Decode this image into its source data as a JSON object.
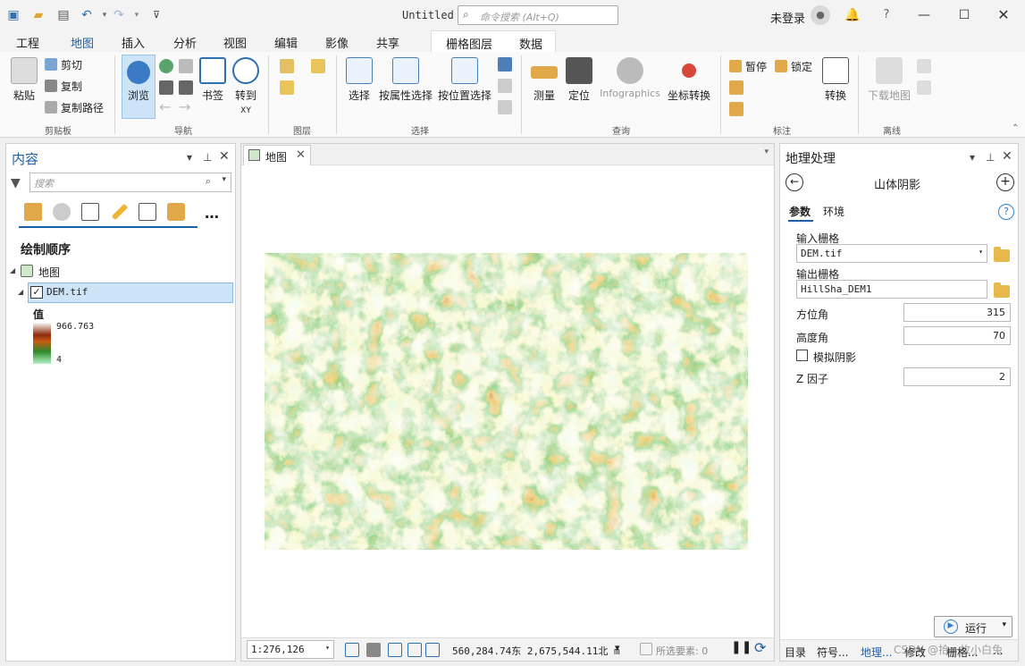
{
  "titlebar": {
    "title": "Untitled",
    "search_placeholder": "命令搜索 (Alt+Q)",
    "login": "未登录",
    "help": "?",
    "icons": [
      "new-project-icon",
      "open-icon",
      "save-icon",
      "undo-icon",
      "redo-icon",
      "customize-icon"
    ]
  },
  "tabs": [
    "工程",
    "地图",
    "插入",
    "分析",
    "视图",
    "编辑",
    "影像",
    "共享"
  ],
  "active_tab": "地图",
  "context_tabs": [
    "栅格图层",
    "数据"
  ],
  "ribbon": {
    "clipboard": {
      "paste": "粘贴",
      "cut": "剪切",
      "copy": "复制",
      "copy_path": "复制路径",
      "label": "剪贴板"
    },
    "navigate": {
      "explore": "浏览",
      "bookmarks": "书签",
      "goto": "转到",
      "goto_sub": "XY",
      "label": "导航"
    },
    "layer": {
      "label": "图层"
    },
    "selection": {
      "select": "选择",
      "by_attr": "按属性选择",
      "by_loc": "按位置选择",
      "label": "选择"
    },
    "inquiry": {
      "measure": "测量",
      "locate": "定位",
      "infographics": "Infographics",
      "coord": "坐标转换",
      "label": "查询"
    },
    "labeling": {
      "pause": "暂停",
      "lock": "锁定",
      "convert": "转换",
      "label": "标注"
    },
    "offline": {
      "download": "下载地图",
      "label": "离线"
    }
  },
  "contents": {
    "title": "内容",
    "search_placeholder": "搜索",
    "drawing_order": "绘制顺序",
    "map_name": "地图",
    "layer_name": "DEM.tif",
    "value_label": "值",
    "max_value": "966.763",
    "min_value": "4"
  },
  "map_view": {
    "tab_label": "地图",
    "scale": "1:276,126",
    "coords": "560,284.74东 2,675,544.11北 m",
    "selected": "所选要素: 0"
  },
  "geoprocessing": {
    "title": "地理处理",
    "tool_name": "山体阴影",
    "tab_params": "参数",
    "tab_env": "环境",
    "input_raster_label": "输入栅格",
    "input_raster_value": "DEM.tif",
    "output_raster_label": "输出栅格",
    "output_raster_value": "HillSha_DEM1",
    "azimuth_label": "方位角",
    "azimuth_value": "315",
    "altitude_label": "高度角",
    "altitude_value": "70",
    "model_shadows_label": "模拟阴影",
    "z_factor_label": "Z 因子",
    "z_factor_value": "2",
    "run_label": "运行"
  },
  "bottom_tabs": [
    "目录",
    "符号...",
    "地理...",
    "修改",
    "栅格...",
    "..."
  ],
  "watermark": "CSDN @拾一枚小白兔"
}
